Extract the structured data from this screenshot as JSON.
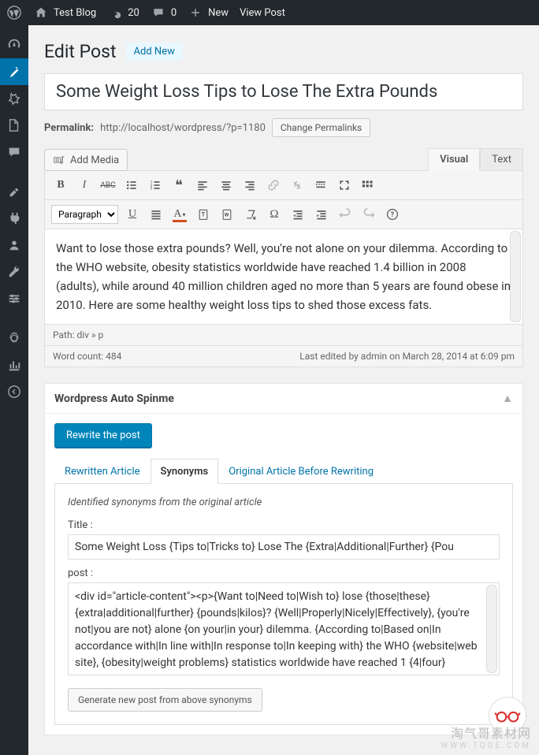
{
  "adminBar": {
    "siteTitle": "Test Blog",
    "updateCount": "20",
    "commentCount": "0",
    "newLabel": "New",
    "viewPostLabel": "View Post"
  },
  "page": {
    "heading": "Edit Post",
    "addNewLabel": "Add New",
    "postTitle": "Some Weight Loss Tips to Lose The Extra Pounds",
    "permalinkLabel": "Permalink:",
    "permalinkUrl": "http://localhost/wordpress/?p=1180",
    "changePermalinksLabel": "Change Permalinks",
    "addMediaLabel": "Add Media"
  },
  "editor": {
    "tabVisual": "Visual",
    "tabText": "Text",
    "formatDropdown": "Paragraph",
    "content": "Want to lose those extra pounds? Well, you're not alone on your dilemma. According to the WHO website, obesity statistics worldwide have reached 1.4 billion in 2008 (adults), while around 40 million children aged no more than 5 years are found obese in 2010. Here are some healthy weight loss tips to shed those excess fats.",
    "path": "Path: div » p",
    "wordCountLabel": "Word count: 484",
    "lastEdited": "Last edited by admin on March 28, 2014 at 6:09 pm"
  },
  "spinBox": {
    "title": "Wordpress Auto Spinme",
    "rewriteBtn": "Rewrite the post",
    "tabs": {
      "rewritten": "Rewritten Article",
      "synonyms": "Synonyms",
      "original": "Original Article Before Rewriting"
    },
    "identifiedHeading": "Identified synonyms from the original article",
    "titleLabel": "Title :",
    "synTitle": "Some Weight Loss {Tips to|Tricks to} Lose The {Extra|Additional|Further} {Pou",
    "postLabel": "post :",
    "synPost": "<div id=\"article-content\"><p>{Want to|Need to|Wish to} lose {those|these} {extra|additional|further} {pounds|kilos}? {Well|Properly|Nicely|Effectively}, {you're not|you are not} alone {on your|in your} dilemma. {According to|Based on|In accordance with|In line with|In response to|In keeping with} the WHO {website|web site}, {obesity|weight problems} statistics worldwide have reached 1 {4|four}",
    "generateBtn": "Generate new post from above synonyms"
  },
  "watermark": {
    "main": "淘气哥素材网",
    "sub": "WWW.TQGE.COM"
  }
}
